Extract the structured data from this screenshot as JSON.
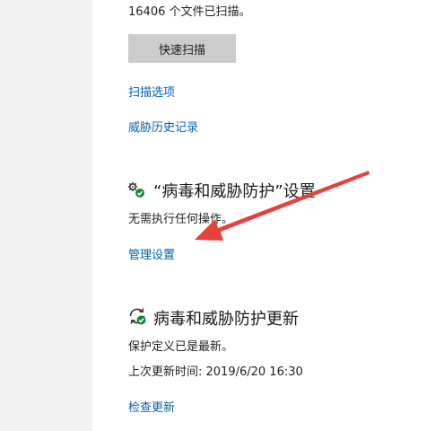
{
  "scan": {
    "file_count_text": "16406 个文件已扫描。",
    "quick_scan_label": "快速扫描",
    "scan_options_link": "扫描选项",
    "threat_history_link": "威胁历史记录"
  },
  "settings_section": {
    "icon": "settings-gear-check-icon",
    "heading": "“病毒和威胁防护”设置",
    "status": "无需执行任何操作。",
    "manage_link": "管理设置"
  },
  "updates_section": {
    "icon": "refresh-check-icon",
    "heading": "病毒和威胁防护更新",
    "status": "保护定义已是最新。",
    "last_update": "上次更新时间: 2019/6/20 16:30",
    "check_link": "检查更新"
  },
  "annotation": {
    "icon": "red-arrow-annotation",
    "color": "#e8413c"
  }
}
